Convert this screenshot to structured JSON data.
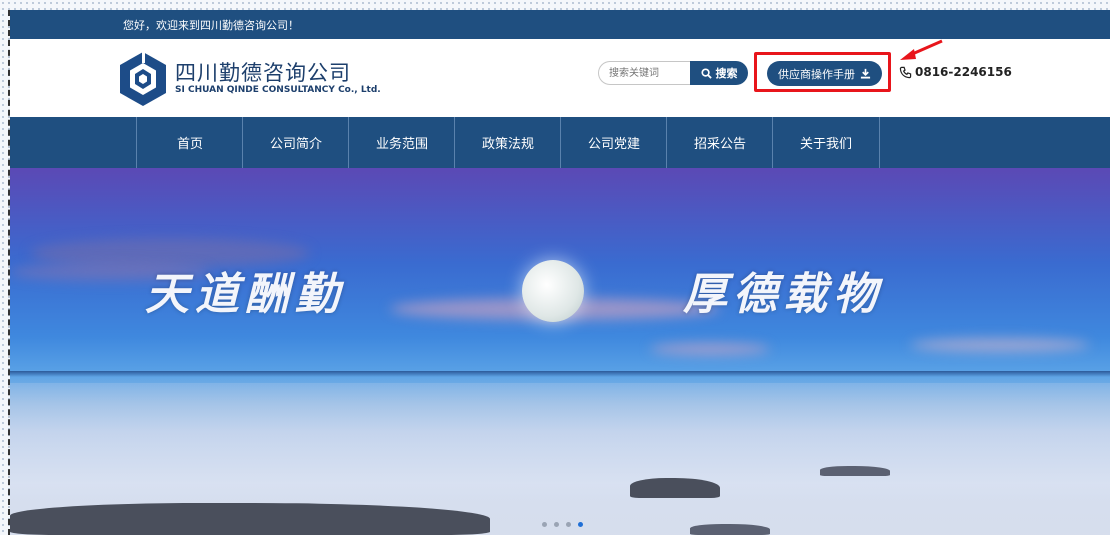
{
  "topbar": {
    "welcome": "您好，欢迎来到四川勤德咨询公司！"
  },
  "header": {
    "logo_cn": "四川勤德咨询公司",
    "logo_en": "SI CHUAN QINDE CONSULTANCY Co., Ltd.",
    "search_placeholder": "搜索关键词",
    "search_button": "搜索",
    "supplier_button": "供应商操作手册",
    "phone": "0816-2246156"
  },
  "nav": {
    "items": [
      "首页",
      "公司简介",
      "业务范围",
      "政策法规",
      "公司党建",
      "招采公告",
      "关于我们"
    ]
  },
  "banner": {
    "left_slogan": "天道酬勤",
    "right_slogan": "厚德载物",
    "slide_count": 4,
    "active_slide": 4
  },
  "colors": {
    "brand": "#1f4f80",
    "highlight": "#e8151b",
    "active_dot": "#1f6fd6"
  },
  "icons": [
    "search-icon",
    "download-icon",
    "phone-icon",
    "company-logo-icon",
    "red-arrow-annotation"
  ]
}
